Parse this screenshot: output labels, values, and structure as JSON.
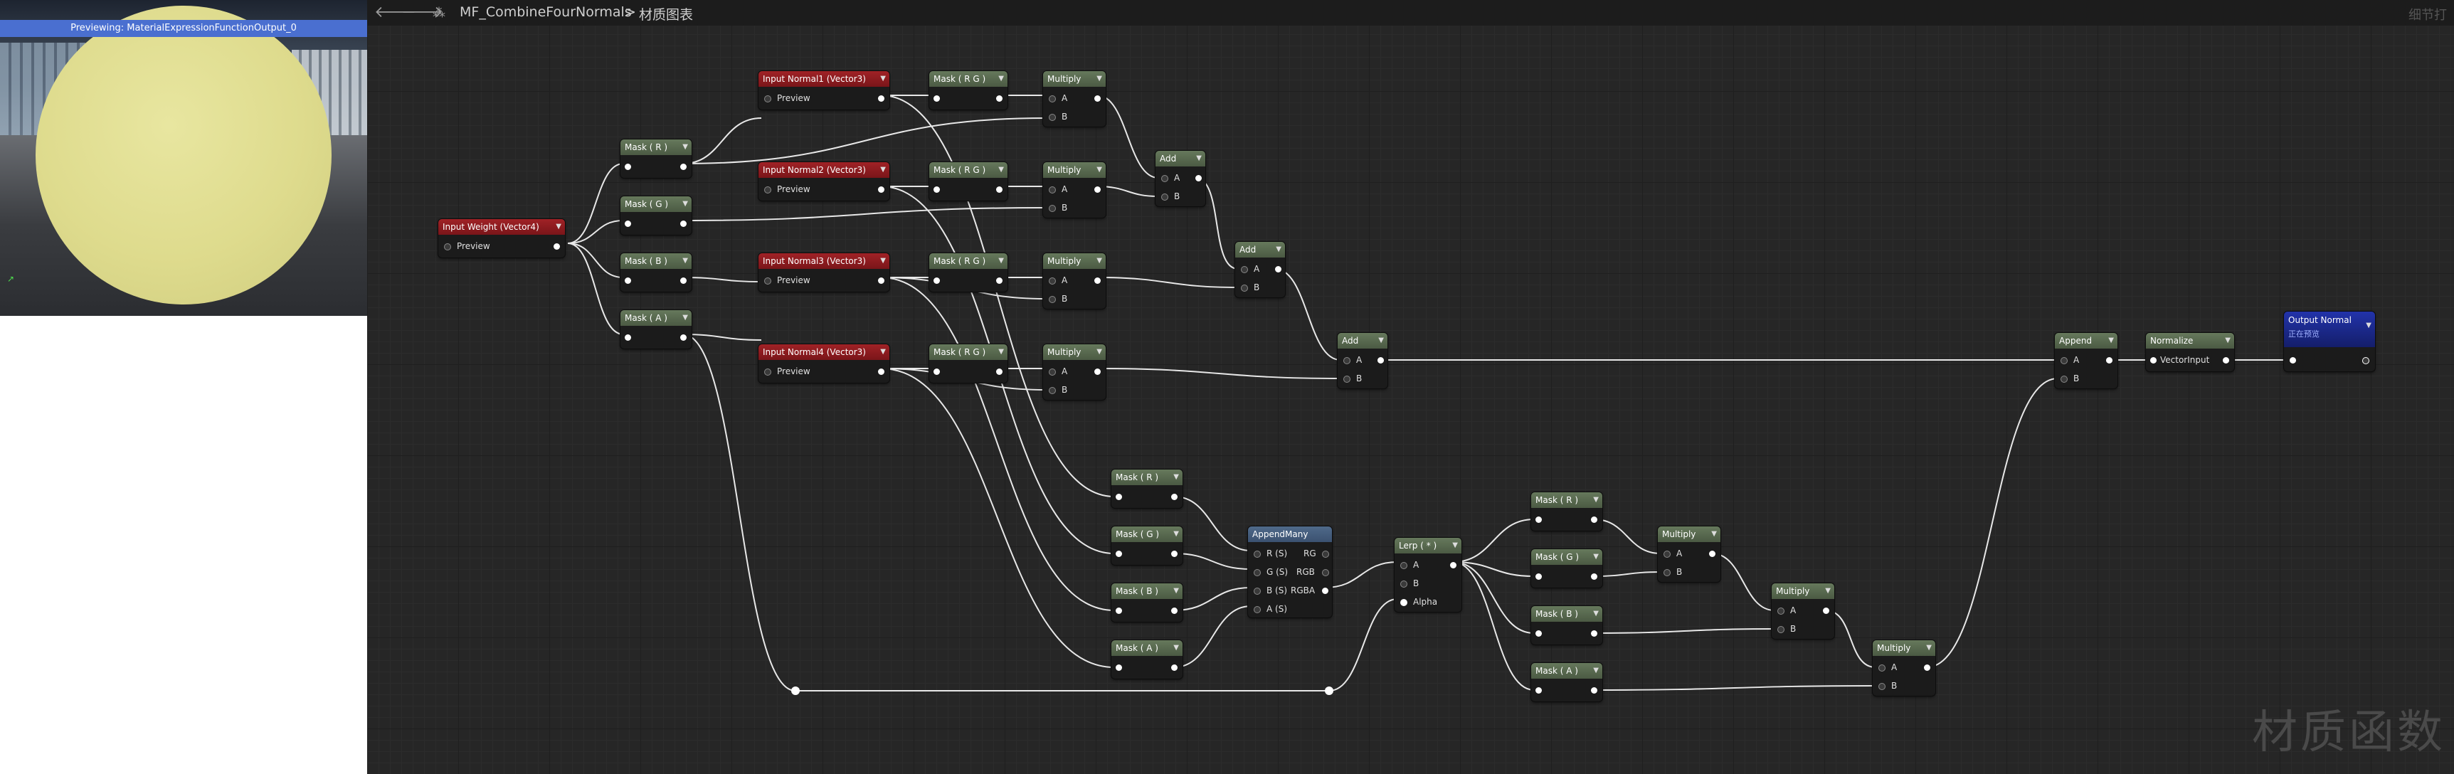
{
  "preview": {
    "banner": "Previewing: MaterialExpressionFunctionOutput_0"
  },
  "breadcrumb": {
    "asset": "MF_CombineFourNormals",
    "separator": ">",
    "graph": "材质图表",
    "right_text": "细节打"
  },
  "nodes": {
    "input_weight": {
      "title": "Input Weight (Vector4)",
      "pin": "Preview"
    },
    "input_n1": {
      "title": "Input Normal1 (Vector3)",
      "pin": "Preview"
    },
    "input_n2": {
      "title": "Input Normal2 (Vector3)",
      "pin": "Preview"
    },
    "input_n3": {
      "title": "Input Normal3 (Vector3)",
      "pin": "Preview"
    },
    "input_n4": {
      "title": "Input Normal4 (Vector3)",
      "pin": "Preview"
    },
    "mask_r": "Mask ( R )",
    "mask_g": "Mask ( G )",
    "mask_b": "Mask ( B )",
    "mask_a": "Mask ( A )",
    "mask_rg": "Mask ( R G )",
    "multiply": "Multiply",
    "add": "Add",
    "append": "Append",
    "normalize": "Normalize",
    "normalize_pin": "VectorInput",
    "appendmany": "AppendMany",
    "lerp": "Lerp ( * )",
    "output": {
      "title": "Output Normal",
      "subtitle": "正在预览"
    },
    "pin_a": "A",
    "pin_b": "B",
    "pin_alpha": "Alpha",
    "am_inputs": [
      "R (S)",
      "G (S)",
      "B (S)",
      "A (S)"
    ],
    "am_outputs": [
      "RG",
      "RGB",
      "RGBA"
    ]
  },
  "watermark": "材质函数"
}
